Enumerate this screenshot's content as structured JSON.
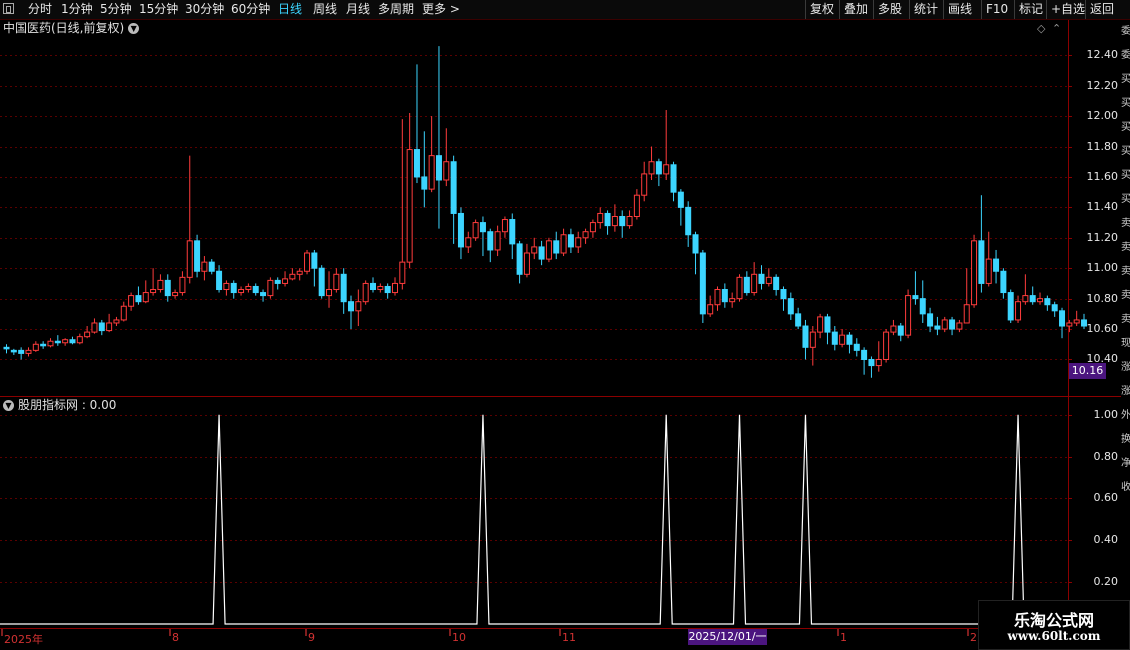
{
  "toolbar": {
    "left_tabs": [
      {
        "label": "分时",
        "active": false
      },
      {
        "label": "1分钟",
        "active": false
      },
      {
        "label": "5分钟",
        "active": false
      },
      {
        "label": "15分钟",
        "active": false
      },
      {
        "label": "30分钟",
        "active": false
      },
      {
        "label": "60分钟",
        "active": false
      },
      {
        "label": "日线",
        "active": true
      },
      {
        "label": "周线",
        "active": false
      },
      {
        "label": "月线",
        "active": false
      },
      {
        "label": "多周期",
        "active": false
      },
      {
        "label": "更多 >",
        "active": false
      }
    ],
    "right_buttons": [
      "复权",
      "叠加",
      "多股",
      "统计",
      "画线",
      "F10",
      "标记",
      "+自选",
      "返回"
    ]
  },
  "main_chart": {
    "title": "中国医药(日线,前复权)",
    "last_price": "10.16",
    "y_ticks": [
      "12.40",
      "12.20",
      "12.00",
      "11.80",
      "11.60",
      "11.40",
      "11.20",
      "11.00",
      "10.80",
      "10.60",
      "10.40"
    ],
    "y_min": 10.16,
    "y_max": 12.52
  },
  "indicator": {
    "title": "股朋指标网 : 0.00",
    "y_ticks": [
      "1.00",
      "0.80",
      "0.60",
      "0.40",
      "0.20"
    ]
  },
  "date_axis": {
    "labels": [
      "2025年",
      "8",
      "9",
      "10",
      "11",
      "1",
      "2"
    ],
    "cursor": "2025/12/01/一"
  },
  "side_strip": [
    "委",
    "委",
    "买",
    "买",
    "买",
    "买",
    "买",
    "买",
    "卖",
    "卖",
    "卖",
    "卖",
    "卖",
    "现",
    "涨",
    "涨",
    "外",
    "换",
    "净",
    "收"
  ],
  "watermark": {
    "title": "乐淘公式网",
    "url": "www.60lt.com"
  },
  "colors": {
    "up": "#ff3c3c",
    "down": "#3cd5ff",
    "grid": "#5a0000",
    "axis": "#8b0000",
    "accent": "#4b157f"
  },
  "chart_data": [
    {
      "type": "candlestick",
      "title": "中国医药(日线,前复权)",
      "ylim": [
        10.16,
        12.52
      ],
      "candles": [
        [
          10.48,
          10.47,
          10.5,
          10.44
        ],
        [
          10.46,
          10.45,
          10.47,
          10.43
        ],
        [
          10.46,
          10.44,
          10.48,
          10.4
        ],
        [
          10.44,
          10.46,
          10.48,
          10.42
        ],
        [
          10.46,
          10.5,
          10.52,
          10.45
        ],
        [
          10.5,
          10.49,
          10.52,
          10.47
        ],
        [
          10.49,
          10.52,
          10.54,
          10.48
        ],
        [
          10.52,
          10.51,
          10.56,
          10.49
        ],
        [
          10.51,
          10.53,
          10.54,
          10.49
        ],
        [
          10.53,
          10.51,
          10.55,
          10.5
        ],
        [
          10.51,
          10.55,
          10.57,
          10.5
        ],
        [
          10.55,
          10.58,
          10.62,
          10.54
        ],
        [
          10.58,
          10.64,
          10.67,
          10.57
        ],
        [
          10.64,
          10.59,
          10.66,
          10.56
        ],
        [
          10.59,
          10.64,
          10.7,
          10.58
        ],
        [
          10.64,
          10.66,
          10.68,
          10.62
        ],
        [
          10.66,
          10.75,
          10.78,
          10.65
        ],
        [
          10.75,
          10.82,
          10.84,
          10.72
        ],
        [
          10.82,
          10.78,
          10.88,
          10.76
        ],
        [
          10.78,
          10.84,
          10.92,
          10.77
        ],
        [
          10.84,
          10.86,
          11.0,
          10.82
        ],
        [
          10.86,
          10.92,
          10.96,
          10.84
        ],
        [
          10.92,
          10.82,
          10.96,
          10.78
        ],
        [
          10.82,
          10.84,
          10.86,
          10.8
        ],
        [
          10.84,
          10.94,
          10.98,
          10.82
        ],
        [
          10.94,
          11.18,
          11.74,
          10.9
        ],
        [
          11.18,
          10.98,
          11.22,
          10.94
        ],
        [
          10.98,
          11.04,
          11.08,
          10.92
        ],
        [
          11.04,
          10.98,
          11.06,
          10.96
        ],
        [
          10.98,
          10.86,
          11.02,
          10.84
        ],
        [
          10.86,
          10.9,
          10.92,
          10.82
        ],
        [
          10.9,
          10.84,
          10.92,
          10.8
        ],
        [
          10.84,
          10.86,
          10.88,
          10.82
        ],
        [
          10.86,
          10.88,
          10.9,
          10.84
        ],
        [
          10.88,
          10.84,
          10.9,
          10.82
        ],
        [
          10.84,
          10.82,
          10.86,
          10.78
        ],
        [
          10.82,
          10.92,
          10.94,
          10.8
        ],
        [
          10.92,
          10.9,
          10.94,
          10.86
        ],
        [
          10.9,
          10.93,
          10.98,
          10.88
        ],
        [
          10.93,
          10.96,
          11.0,
          10.92
        ],
        [
          10.96,
          10.98,
          11.0,
          10.92
        ],
        [
          10.98,
          11.1,
          11.12,
          10.96
        ],
        [
          11.1,
          11.0,
          11.12,
          10.88
        ],
        [
          11.0,
          10.82,
          11.02,
          10.8
        ],
        [
          10.82,
          10.86,
          10.98,
          10.74
        ],
        [
          10.86,
          10.96,
          11.0,
          10.84
        ],
        [
          10.96,
          10.78,
          11.0,
          10.7
        ],
        [
          10.78,
          10.72,
          10.82,
          10.6
        ],
        [
          10.72,
          10.78,
          10.86,
          10.62
        ],
        [
          10.78,
          10.9,
          10.92,
          10.76
        ],
        [
          10.9,
          10.86,
          10.94,
          10.84
        ],
        [
          10.86,
          10.88,
          10.9,
          10.84
        ],
        [
          10.88,
          10.84,
          10.9,
          10.8
        ],
        [
          10.84,
          10.9,
          10.94,
          10.82
        ],
        [
          10.9,
          11.04,
          11.98,
          10.86
        ],
        [
          11.04,
          11.78,
          12.02,
          11.0
        ],
        [
          11.78,
          11.6,
          12.34,
          11.56
        ],
        [
          11.6,
          11.52,
          11.9,
          11.4
        ],
        [
          11.52,
          11.74,
          12.0,
          11.5
        ],
        [
          11.74,
          11.58,
          12.46,
          11.26
        ],
        [
          11.58,
          11.7,
          11.92,
          11.54
        ],
        [
          11.7,
          11.36,
          11.74,
          11.16
        ],
        [
          11.36,
          11.14,
          11.4,
          11.06
        ],
        [
          11.14,
          11.2,
          11.24,
          11.1
        ],
        [
          11.2,
          11.3,
          11.32,
          11.18
        ],
        [
          11.3,
          11.24,
          11.34,
          11.08
        ],
        [
          11.24,
          11.12,
          11.26,
          11.04
        ],
        [
          11.12,
          11.24,
          11.28,
          11.08
        ],
        [
          11.24,
          11.32,
          11.34,
          11.2
        ],
        [
          11.32,
          11.16,
          11.36,
          11.06
        ],
        [
          11.16,
          10.96,
          11.18,
          10.9
        ],
        [
          10.96,
          11.1,
          11.16,
          10.94
        ],
        [
          11.1,
          11.14,
          11.2,
          11.06
        ],
        [
          11.14,
          11.06,
          11.18,
          11.02
        ],
        [
          11.06,
          11.18,
          11.2,
          11.04
        ],
        [
          11.18,
          11.1,
          11.24,
          11.06
        ],
        [
          11.1,
          11.22,
          11.26,
          11.08
        ],
        [
          11.22,
          11.14,
          11.26,
          11.1
        ],
        [
          11.14,
          11.2,
          11.24,
          11.1
        ],
        [
          11.2,
          11.24,
          11.26,
          11.16
        ],
        [
          11.24,
          11.3,
          11.32,
          11.2
        ],
        [
          11.3,
          11.36,
          11.4,
          11.26
        ],
        [
          11.36,
          11.28,
          11.38,
          11.22
        ],
        [
          11.28,
          11.34,
          11.42,
          11.24
        ],
        [
          11.34,
          11.28,
          11.38,
          11.2
        ],
        [
          11.28,
          11.34,
          11.38,
          11.26
        ],
        [
          11.34,
          11.48,
          11.52,
          11.32
        ],
        [
          11.48,
          11.62,
          11.7,
          11.44
        ],
        [
          11.62,
          11.7,
          11.8,
          11.58
        ],
        [
          11.7,
          11.62,
          11.72,
          11.54
        ],
        [
          11.62,
          11.68,
          12.04,
          11.58
        ],
        [
          11.68,
          11.5,
          11.7,
          11.44
        ],
        [
          11.5,
          11.4,
          11.52,
          11.28
        ],
        [
          11.4,
          11.22,
          11.44,
          11.14
        ],
        [
          11.22,
          11.1,
          11.24,
          10.96
        ],
        [
          11.1,
          10.7,
          11.12,
          10.64
        ],
        [
          10.7,
          10.76,
          10.82,
          10.68
        ],
        [
          10.76,
          10.86,
          10.88,
          10.72
        ],
        [
          10.86,
          10.78,
          10.9,
          10.74
        ],
        [
          10.78,
          10.8,
          10.84,
          10.74
        ],
        [
          10.8,
          10.94,
          10.96,
          10.78
        ],
        [
          10.94,
          10.84,
          10.98,
          10.82
        ],
        [
          10.84,
          10.96,
          11.04,
          10.82
        ],
        [
          10.96,
          10.9,
          11.02,
          10.86
        ],
        [
          10.9,
          10.94,
          11.0,
          10.88
        ],
        [
          10.94,
          10.86,
          10.96,
          10.82
        ],
        [
          10.86,
          10.8,
          10.88,
          10.72
        ],
        [
          10.8,
          10.7,
          10.84,
          10.66
        ],
        [
          10.7,
          10.62,
          10.74,
          10.6
        ],
        [
          10.62,
          10.48,
          10.66,
          10.4
        ],
        [
          10.48,
          10.58,
          10.62,
          10.36
        ],
        [
          10.58,
          10.68,
          10.7,
          10.54
        ],
        [
          10.68,
          10.58,
          10.7,
          10.5
        ],
        [
          10.58,
          10.5,
          10.62,
          10.46
        ],
        [
          10.5,
          10.56,
          10.6,
          10.48
        ],
        [
          10.56,
          10.5,
          10.58,
          10.44
        ],
        [
          10.5,
          10.46,
          10.54,
          10.42
        ],
        [
          10.46,
          10.4,
          10.48,
          10.3
        ],
        [
          10.4,
          10.36,
          10.42,
          10.28
        ],
        [
          10.36,
          10.4,
          10.52,
          10.32
        ],
        [
          10.4,
          10.58,
          10.6,
          10.38
        ],
        [
          10.58,
          10.62,
          10.66,
          10.56
        ],
        [
          10.62,
          10.56,
          10.64,
          10.52
        ],
        [
          10.56,
          10.82,
          10.86,
          10.54
        ],
        [
          10.82,
          10.8,
          10.98,
          10.76
        ],
        [
          10.8,
          10.7,
          10.92,
          10.64
        ],
        [
          10.7,
          10.62,
          10.74,
          10.58
        ],
        [
          10.62,
          10.6,
          10.68,
          10.56
        ],
        [
          10.6,
          10.66,
          10.68,
          10.58
        ],
        [
          10.66,
          10.6,
          10.68,
          10.56
        ],
        [
          10.6,
          10.64,
          10.66,
          10.58
        ],
        [
          10.64,
          10.76,
          11.0,
          10.74
        ],
        [
          10.76,
          11.18,
          11.22,
          10.74
        ],
        [
          11.18,
          10.9,
          11.48,
          10.84
        ],
        [
          10.9,
          11.06,
          11.24,
          10.88
        ],
        [
          11.06,
          10.98,
          11.12,
          10.9
        ],
        [
          10.98,
          10.84,
          11.0,
          10.8
        ],
        [
          10.84,
          10.66,
          10.86,
          10.64
        ],
        [
          10.66,
          10.78,
          10.82,
          10.64
        ],
        [
          10.78,
          10.82,
          10.96,
          10.76
        ],
        [
          10.82,
          10.78,
          10.88,
          10.76
        ],
        [
          10.78,
          10.8,
          10.84,
          10.76
        ],
        [
          10.8,
          10.76,
          10.82,
          10.72
        ],
        [
          10.76,
          10.72,
          10.78,
          10.68
        ],
        [
          10.72,
          10.62,
          10.74,
          10.54
        ],
        [
          10.62,
          10.64,
          10.66,
          10.58
        ],
        [
          10.64,
          10.66,
          10.72,
          10.62
        ],
        [
          10.66,
          10.62,
          10.7,
          10.6
        ]
      ]
    },
    {
      "type": "line",
      "title": "股朋指标网 : 0.00",
      "ylim": [
        0,
        1.08
      ],
      "spikes_at_candle_index": [
        29,
        65,
        90,
        100,
        109,
        138
      ],
      "baseline": 0,
      "peak": 1.0
    }
  ]
}
